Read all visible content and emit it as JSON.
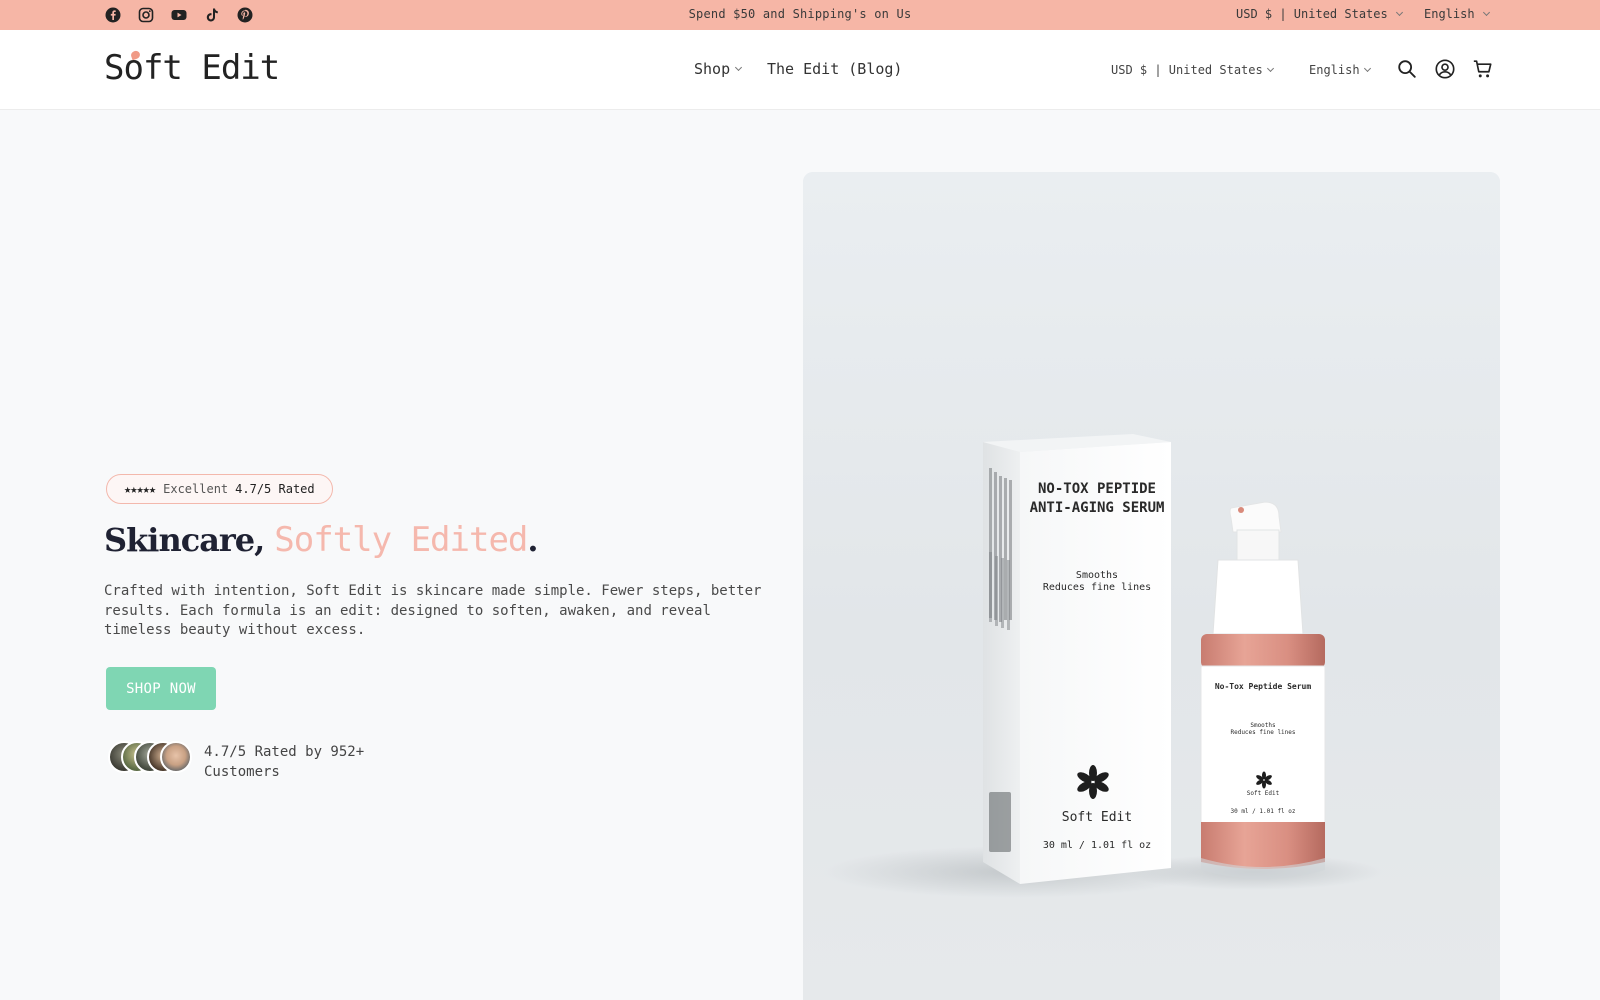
{
  "announcement": {
    "message": "Spend $50 and Shipping's on Us",
    "currency": "USD $ | United States",
    "language": "English",
    "social": [
      "facebook-icon",
      "instagram-icon",
      "youtube-icon",
      "tiktok-icon",
      "pinterest-icon"
    ]
  },
  "header": {
    "logo": "Soft Edit",
    "nav": [
      {
        "label": "Shop"
      },
      {
        "label": "The Edit (Blog)"
      }
    ],
    "currency": "USD $ | United States",
    "language": "English",
    "icons": [
      "search-icon",
      "account-icon",
      "cart-icon"
    ]
  },
  "hero": {
    "badge_stars": "★★★★★",
    "badge_label": "Excellent",
    "badge_rating": "4.7/5 Rated",
    "headline_main": "Skincare,",
    "headline_accent": "Softly Edited",
    "headline_end": ".",
    "description": "Crafted with intention, Soft Edit is skincare made simple. Fewer steps, better results. Each formula is an edit: designed to soften, awaken, and reveal timeless beauty without excess.",
    "cta": "SHOP NOW",
    "social_proof": "4.7/5 Rated by 952+ Customers"
  },
  "product_image": {
    "box_title": "NO-TOX PEPTIDE ANTI-AGING SERUM",
    "box_subtitle_1": "Smooths",
    "box_subtitle_2": "Reduces fine lines",
    "box_brand": "Soft Edit",
    "box_volume": "30 ml / 1.01 fl oz",
    "bottle_title": "No-Tox Peptide Serum",
    "bottle_sub_1": "Smooths",
    "bottle_sub_2": "Reduces fine lines",
    "bottle_brand": "Soft Edit",
    "bottle_volume": "30 ml / 1.01 fl oz"
  },
  "colors": {
    "announcement_bg": "#f6b6a6",
    "accent_pink": "#f5b8ad",
    "cta_green": "#7fd6b3",
    "headline_dark": "#1f2233"
  }
}
